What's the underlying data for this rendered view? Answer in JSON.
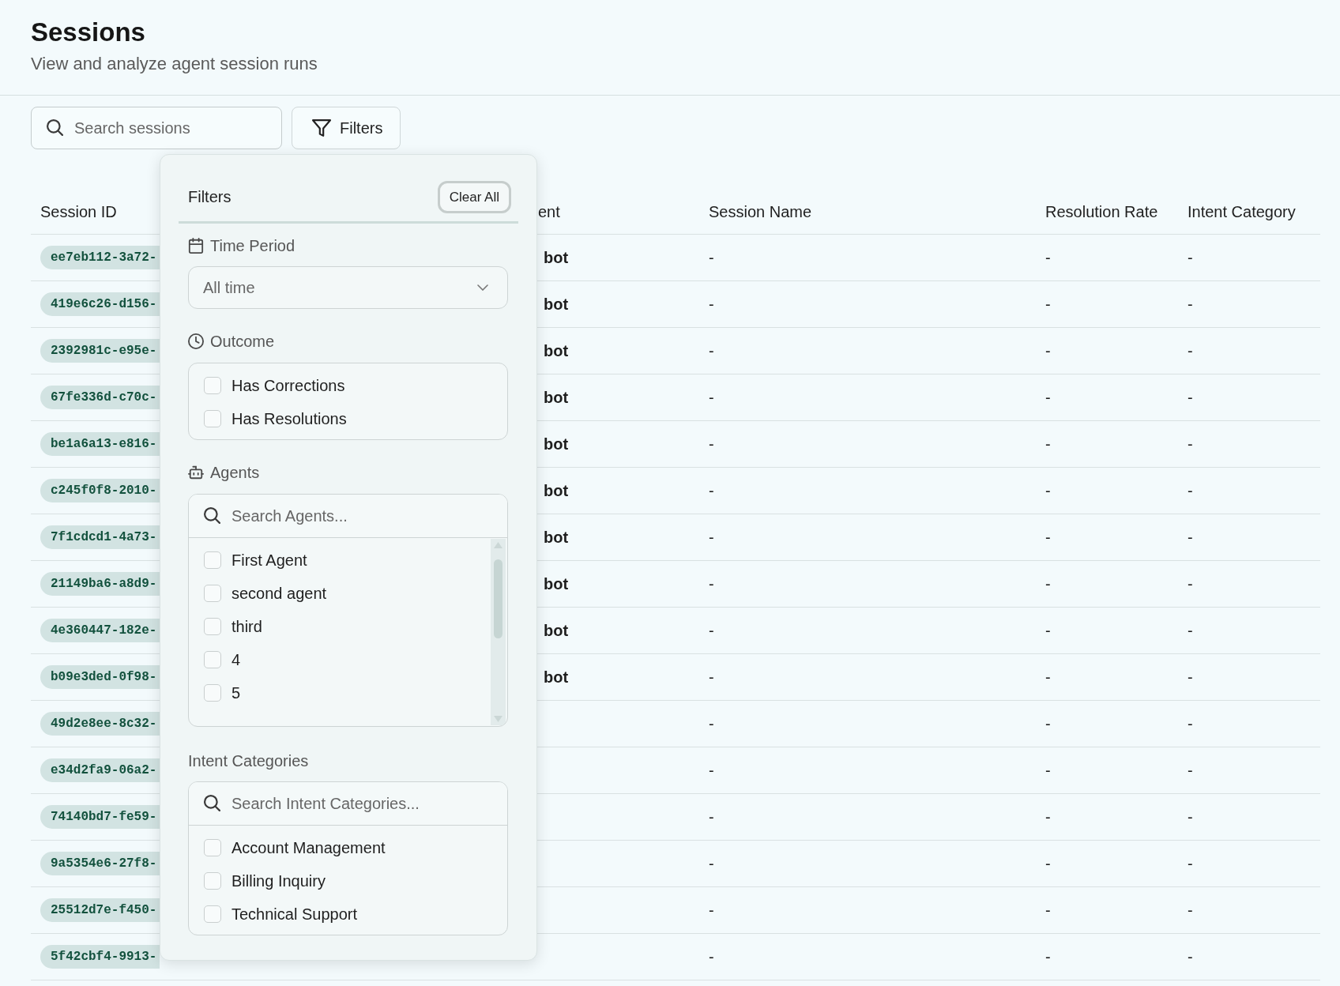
{
  "page": {
    "title": "Sessions",
    "subtitle": "View and analyze agent session runs"
  },
  "toolbar": {
    "search": {
      "placeholder": "Search sessions"
    },
    "filters_button": "Filters"
  },
  "table": {
    "columns": [
      "Session ID",
      "ent",
      "Session Name",
      "Resolution Rate",
      "Intent Category"
    ],
    "rows": [
      {
        "session_id": "ee7eb112-3a72-",
        "agent": "bot",
        "session_name": "-",
        "resolution_rate": "-",
        "intent_category": "-"
      },
      {
        "session_id": "419e6c26-d156-",
        "agent": "bot",
        "session_name": "-",
        "resolution_rate": "-",
        "intent_category": "-"
      },
      {
        "session_id": "2392981c-e95e-",
        "agent": "bot",
        "session_name": "-",
        "resolution_rate": "-",
        "intent_category": "-"
      },
      {
        "session_id": "67fe336d-c70c-",
        "agent": "bot",
        "session_name": "-",
        "resolution_rate": "-",
        "intent_category": "-"
      },
      {
        "session_id": "be1a6a13-e816-",
        "agent": "bot",
        "session_name": "-",
        "resolution_rate": "-",
        "intent_category": "-"
      },
      {
        "session_id": "c245f0f8-2010-",
        "agent": "bot",
        "session_name": "-",
        "resolution_rate": "-",
        "intent_category": "-"
      },
      {
        "session_id": "7f1cdcd1-4a73-",
        "agent": "bot",
        "session_name": "-",
        "resolution_rate": "-",
        "intent_category": "-"
      },
      {
        "session_id": "21149ba6-a8d9-",
        "agent": "bot",
        "session_name": "-",
        "resolution_rate": "-",
        "intent_category": "-"
      },
      {
        "session_id": "4e360447-182e-",
        "agent": "bot",
        "session_name": "-",
        "resolution_rate": "-",
        "intent_category": "-"
      },
      {
        "session_id": "b09e3ded-0f98-",
        "agent": "bot",
        "session_name": "-",
        "resolution_rate": "-",
        "intent_category": "-"
      },
      {
        "session_id": "49d2e8ee-8c32-",
        "session_name": "-",
        "resolution_rate": "-",
        "intent_category": "-"
      },
      {
        "session_id": "e34d2fa9-06a2-",
        "session_name": "-",
        "resolution_rate": "-",
        "intent_category": "-"
      },
      {
        "session_id": "74140bd7-fe59-",
        "session_name": "-",
        "resolution_rate": "-",
        "intent_category": "-"
      },
      {
        "session_id": "9a5354e6-27f8-",
        "session_name": "-",
        "resolution_rate": "-",
        "intent_category": "-"
      },
      {
        "session_id": "25512d7e-f450-",
        "session_name": "-",
        "resolution_rate": "-",
        "intent_category": "-"
      },
      {
        "session_id": "5f42cbf4-9913-",
        "session_name": "-",
        "resolution_rate": "-",
        "intent_category": "-"
      }
    ]
  },
  "filter_panel": {
    "title": "Filters",
    "clear_button": {
      "label": "Clear All",
      "focused": true
    },
    "sections": [
      {
        "kind": "select",
        "label": "Time Period",
        "value": "All time"
      },
      {
        "kind": "checklist",
        "label": "Outcome",
        "options": [
          {
            "label": "Has Corrections",
            "checked": false
          },
          {
            "label": "Has Resolutions",
            "checked": false
          }
        ]
      },
      {
        "kind": "searchable_list",
        "label": "Agents",
        "search": {
          "placeholder": "Search Agents..."
        },
        "scrollbar": true,
        "options": [
          {
            "label": "First Agent",
            "checked": false
          },
          {
            "label": "second agent",
            "checked": false
          },
          {
            "label": "third",
            "checked": false
          },
          {
            "label": "4",
            "checked": false
          },
          {
            "label": "5",
            "checked": false
          }
        ]
      },
      {
        "kind": "searchable_list",
        "label": "Intent Categories",
        "search": {
          "placeholder": "Search Intent Categories..."
        },
        "options": [
          {
            "label": "Account Management",
            "checked": false
          },
          {
            "label": "Billing Inquiry",
            "checked": false
          },
          {
            "label": "Technical Support",
            "checked": false
          }
        ]
      }
    ]
  }
}
